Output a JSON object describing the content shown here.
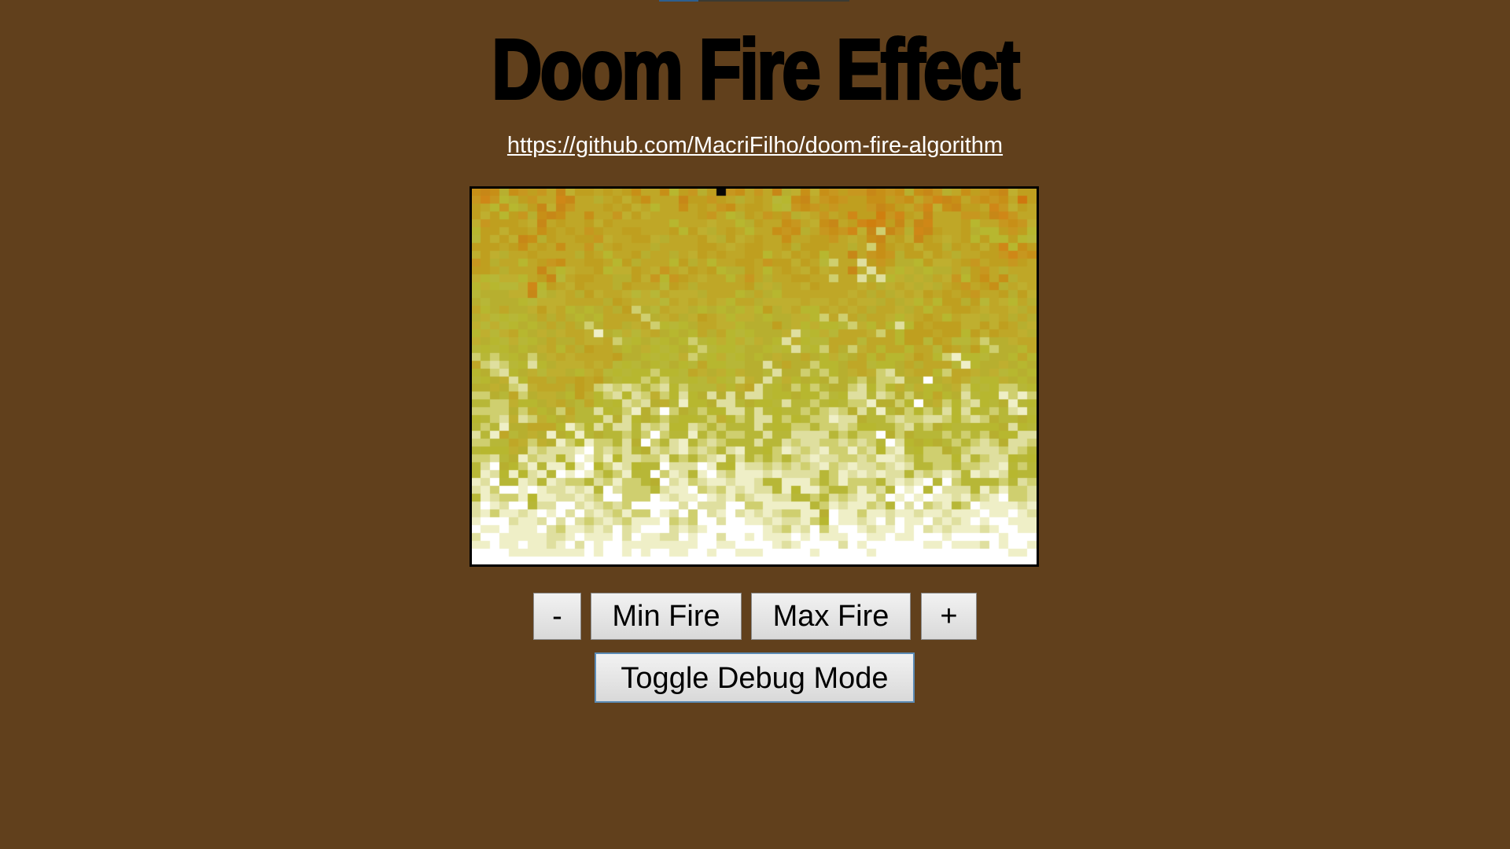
{
  "title": "Doom Fire Effect",
  "repo_link": "https://github.com/MacriFilho/doom-fire-algorithm",
  "fire": {
    "palette_colors": [
      "#070707",
      "#1f0707",
      "#2f0f07",
      "#470f07",
      "#571707",
      "#671f07",
      "#771f07",
      "#8f2707",
      "#9f2f07",
      "#af3f07",
      "#bf4707",
      "#c74707",
      "#df4f07",
      "#df5707",
      "#df5707",
      "#d75f07",
      "#d75f07",
      "#d7670f",
      "#cf6f0f",
      "#cf770f",
      "#cf7f0f",
      "#cf8717",
      "#c78717",
      "#c78f17",
      "#c7971f",
      "#bf9f1f",
      "#bf9f1f",
      "#bfa727",
      "#bfa727",
      "#bfaf2f",
      "#b7af2f",
      "#b7b72f",
      "#b7b737",
      "#cfcf6f",
      "#dfdf9f",
      "#efefc7",
      "#ffffff"
    ]
  },
  "controls": {
    "decrease_label": "-",
    "min_label": "Min Fire",
    "max_label": "Max Fire",
    "increase_label": "+",
    "debug_label": "Toggle Debug Mode"
  }
}
